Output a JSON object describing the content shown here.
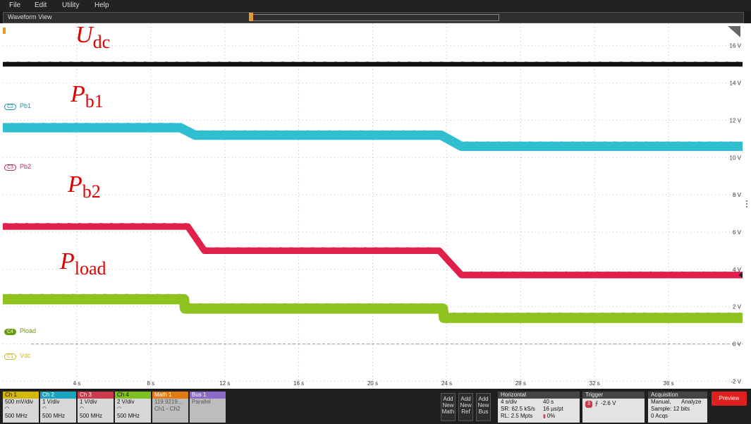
{
  "menu": {
    "file": "File",
    "edit": "Edit",
    "utility": "Utility",
    "help": "Help"
  },
  "window": {
    "title": "Waveform View"
  },
  "scope_labels": {
    "udc": {
      "main": "U",
      "sub": "dc"
    },
    "pb1": {
      "main": "P",
      "sub": "b1"
    },
    "pb2": {
      "main": "P",
      "sub": "b2"
    },
    "pload": {
      "main": "P",
      "sub": "load"
    }
  },
  "channel_tags": [
    {
      "badge": "C2",
      "name": "Pb1",
      "color": "#1a8fa8"
    },
    {
      "badge": "C3",
      "name": "Pb2",
      "color": "#b03050"
    },
    {
      "badge": "C4",
      "name": "Pload",
      "color": "#6a9a10"
    },
    {
      "badge": "C1",
      "name": "Vdc",
      "color": "#c8b820"
    }
  ],
  "chart_data": {
    "type": "line",
    "x_unit": "s",
    "xlim": [
      0,
      40
    ],
    "ylim": [
      -2.4,
      17.2
    ],
    "x_ticks": [
      "4 s",
      "8 s",
      "12 s",
      "16 s",
      "20 s",
      "24 s",
      "28 s",
      "32 s",
      "36 s"
    ],
    "y_ticks": [
      "16 V",
      "14 V",
      "12 V",
      "10 V",
      "8 V",
      "6 V",
      "4 V",
      "2 V",
      "0 V",
      "-2 V"
    ],
    "grid": true,
    "series": [
      {
        "name": "Udc",
        "color": "#111111",
        "thickness_v": 0.25,
        "x": [
          0,
          40
        ],
        "y": [
          15.0,
          15.0
        ]
      },
      {
        "name": "Pb1",
        "color": "#2fbfd0",
        "thickness_v": 0.5,
        "x": [
          0,
          9.6,
          10.4,
          23.7,
          24.8,
          40
        ],
        "y": [
          11.6,
          11.6,
          11.2,
          11.2,
          10.6,
          10.6
        ]
      },
      {
        "name": "Pb2",
        "color": "#e0204a",
        "thickness_v": 0.35,
        "x": [
          0,
          10.0,
          10.9,
          23.6,
          24.8,
          40
        ],
        "y": [
          6.3,
          6.3,
          5.0,
          5.0,
          3.7,
          3.7
        ]
      },
      {
        "name": "Pload",
        "color": "#8ec21e",
        "thickness_v": 0.55,
        "x": [
          0,
          9.8,
          9.85,
          23.8,
          23.85,
          40
        ],
        "y": [
          2.4,
          2.4,
          1.9,
          1.9,
          1.4,
          1.4
        ]
      }
    ]
  },
  "bottom": {
    "channels": [
      {
        "head": "Ch 1",
        "l1": "500 mV/div",
        "l2": "500 MHz",
        "color": "#d4b800"
      },
      {
        "head": "Ch 2",
        "l1": "1 V/div",
        "l2": "500 MHz",
        "color": "#1aa3bf"
      },
      {
        "head": "Ch 3",
        "l1": "1 V/div",
        "l2": "500 MHz",
        "color": "#c83a4c"
      },
      {
        "head": "Ch 4",
        "l1": "2 V/div",
        "l2": "500 MHz",
        "color": "#7fbf1f"
      },
      {
        "head": "Math 1",
        "l1": "119.9219...",
        "l2": "Ch1 - Ch2",
        "color": "#e07a10"
      },
      {
        "head": "Bus 1",
        "l1": "Parallel",
        "l2": "",
        "color": "#8a6bc8"
      }
    ],
    "add": [
      {
        "l1": "Add",
        "l2": "New",
        "l3": "Math"
      },
      {
        "l1": "Add",
        "l2": "New",
        "l3": "Ref"
      },
      {
        "l1": "Add",
        "l2": "New",
        "l3": "Bus"
      }
    ],
    "horizontal": {
      "title": "Horizontal",
      "r1a": "4 s/div",
      "r1b": "40 s",
      "r2a": "SR: 62.5 kS/s",
      "r2b": "16 µs/pt",
      "r3a": "RL: 2.5 Mpts",
      "r3b": "0%"
    },
    "trigger": {
      "title": "Trigger",
      "badge": "3",
      "value": "-2.6 V"
    },
    "acquisition": {
      "title": "Acquisition",
      "r1a": "Manual,",
      "r1b": "Analyze",
      "r2": "Sample: 12 bits",
      "r3": "0 Acqs"
    },
    "preview": "Preview"
  }
}
